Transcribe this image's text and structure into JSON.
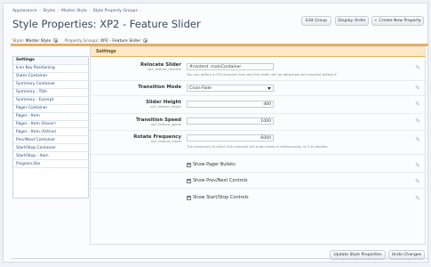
{
  "breadcrumb": [
    "Appearance",
    "Styles",
    "Master Style",
    "Style Property Groups"
  ],
  "breadcrumb_sep": "›",
  "page_title": "Style Properties: XP2 - Feature Slider",
  "header_buttons": {
    "edit_group": "Edit Group",
    "display_order": "Display Order",
    "create_new": "+ Create New Property"
  },
  "filters": {
    "style_label": "Style:",
    "style_value": "Master Style",
    "group_label": "Property Groups:",
    "group_value": "XP2 - Feature Slider"
  },
  "sidebar": {
    "items": [
      {
        "label": "Settings",
        "active": true
      },
      {
        "label": "Icon Key Positioning"
      },
      {
        "label": "Outer Container"
      },
      {
        "label": "Summary Container"
      },
      {
        "label": "Summary - Title"
      },
      {
        "label": "Summary - Excerpt"
      },
      {
        "label": "Pager Container"
      },
      {
        "label": "Pager - Item"
      },
      {
        "label": "Pager - Item (Hover)"
      },
      {
        "label": "Pager - Item (Active)"
      },
      {
        "label": "Prev/Next Container"
      },
      {
        "label": "Start/Stop Container"
      },
      {
        "label": "Start/Stop - Item"
      },
      {
        "label": "Progress Bar"
      }
    ]
  },
  "panel": {
    "title": "Settings",
    "relocate": {
      "label": "Relocate Slider",
      "key": "xp2_feature_relocate",
      "value": "#content .mainContainer",
      "hint": "You can define a CSS element here and the slider will be detached and inserted before it."
    },
    "transition_mode": {
      "label": "Transition Mode",
      "value": "Cross-Fade"
    },
    "slider_height": {
      "label": "Slider Height",
      "key": "xp2_feature_height",
      "value": "400"
    },
    "transition_speed": {
      "label": "Transition Speed",
      "key": "xp2_feature_speed",
      "value": "1000"
    },
    "rotate_frequency": {
      "label": "Rotate Frequency",
      "key": "xp2_feature_rotate",
      "value": "6000",
      "hint": "The frequency at which the carousel will auto-rotate in milliseconds, or 0 to disable."
    },
    "checkboxes": [
      {
        "label": "Show Pager Bullets",
        "checked": true
      },
      {
        "label": "Show Prev/Next Controls",
        "checked": true
      },
      {
        "label": "Show Start/Stop Controls",
        "checked": true
      }
    ]
  },
  "footer_buttons": {
    "update": "Update Style Properties",
    "undo": "Undo Changes"
  },
  "icons": {
    "edit": "pencil-icon",
    "checkmark": "✔"
  }
}
